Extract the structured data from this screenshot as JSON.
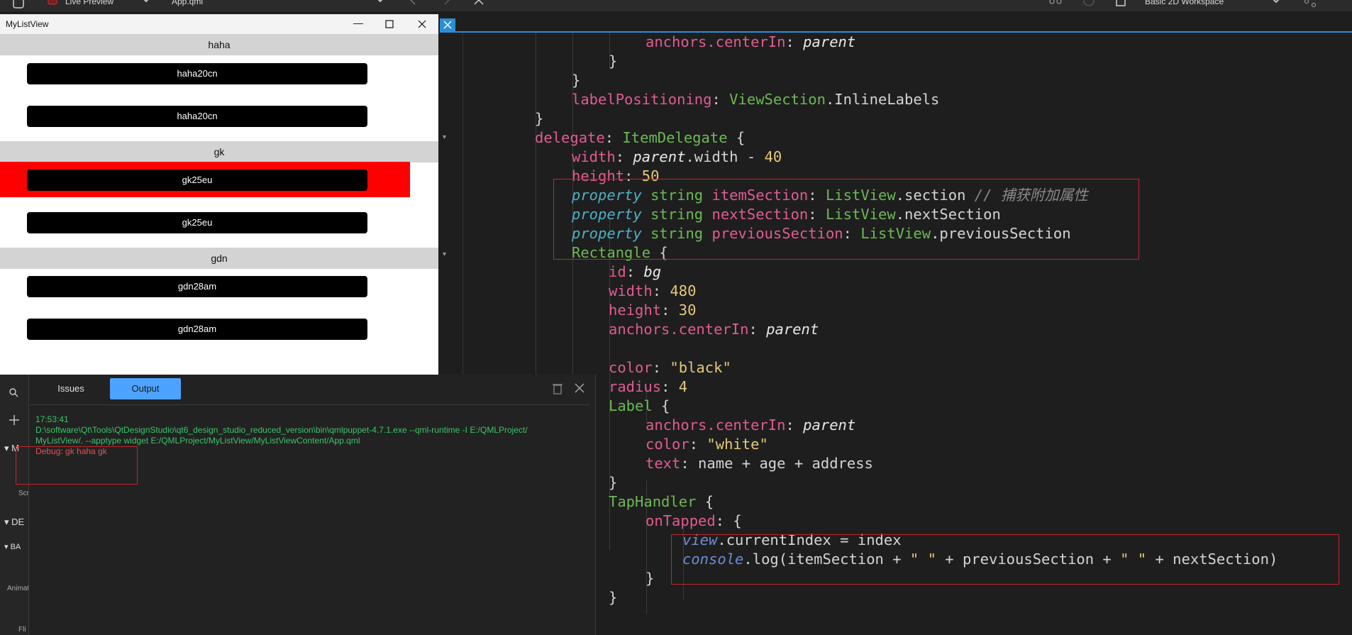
{
  "toolbar": {
    "live_preview_label": "Live Preview",
    "file_label": "App.qml",
    "workspace_label": "Basic 2D Workspace"
  },
  "preview_window": {
    "title": "MyListView",
    "sections": [
      {
        "label": "haha",
        "items": [
          "haha20cn",
          "haha20cn"
        ]
      },
      {
        "label": "gk",
        "items": [
          "gk25eu",
          "gk25eu"
        ]
      },
      {
        "label": "gdn",
        "items": [
          "gdn28am",
          "gdn28am"
        ]
      }
    ],
    "highlight_color": "#ff0000"
  },
  "output_panel": {
    "tabs": [
      "Issues",
      "Output"
    ],
    "active_tab": "Output",
    "time": "17:53:41",
    "command_line1": "D:\\software\\Qt\\Tools\\QtDesignStudio\\qt6_design_studio_reduced_version\\bin\\qmlpuppet-4.7.1.exe --qml-runtime -I E:/QMLProject/",
    "command_line2": "MyListView/. --apptype widget E:/QMLProject/MyListView/MyListViewContent/App.qml",
    "debug_line": "Debug: gk haha gk"
  },
  "left_panel": {
    "labels": [
      "M",
      "Scr",
      "DE",
      "BA",
      "Animat",
      "Fli"
    ]
  },
  "code_lines": [
    "anchors.centerIn: parent",
    "}",
    "}",
    "labelPositioning: ViewSection.InlineLabels",
    "}",
    "delegate: ItemDelegate {",
    "width: parent.width - 40",
    "height: 50",
    "property string itemSection: ListView.section // 捕获附加属性",
    "property string nextSection: ListView.nextSection",
    "property string previousSection: ListView.previousSection",
    "Rectangle {",
    "id: bg",
    "width: 480",
    "height: 30",
    "anchors.centerIn: parent",
    "",
    "color: \"black\"",
    "radius: 4",
    "Label {",
    "anchors.centerIn: parent",
    "color: \"white\"",
    "text: name + age + address",
    "}",
    "TapHandler {",
    "onTapped: {",
    "view.currentIndex = index",
    "console.log(itemSection + \" \" + previousSection + \" \" + nextSection)",
    "}",
    "}"
  ],
  "colors": {
    "accent_blue": "#4da3ff",
    "annotation_red": "#c0262c",
    "output_green": "#3cc46a",
    "debug_red": "#e0535a"
  }
}
